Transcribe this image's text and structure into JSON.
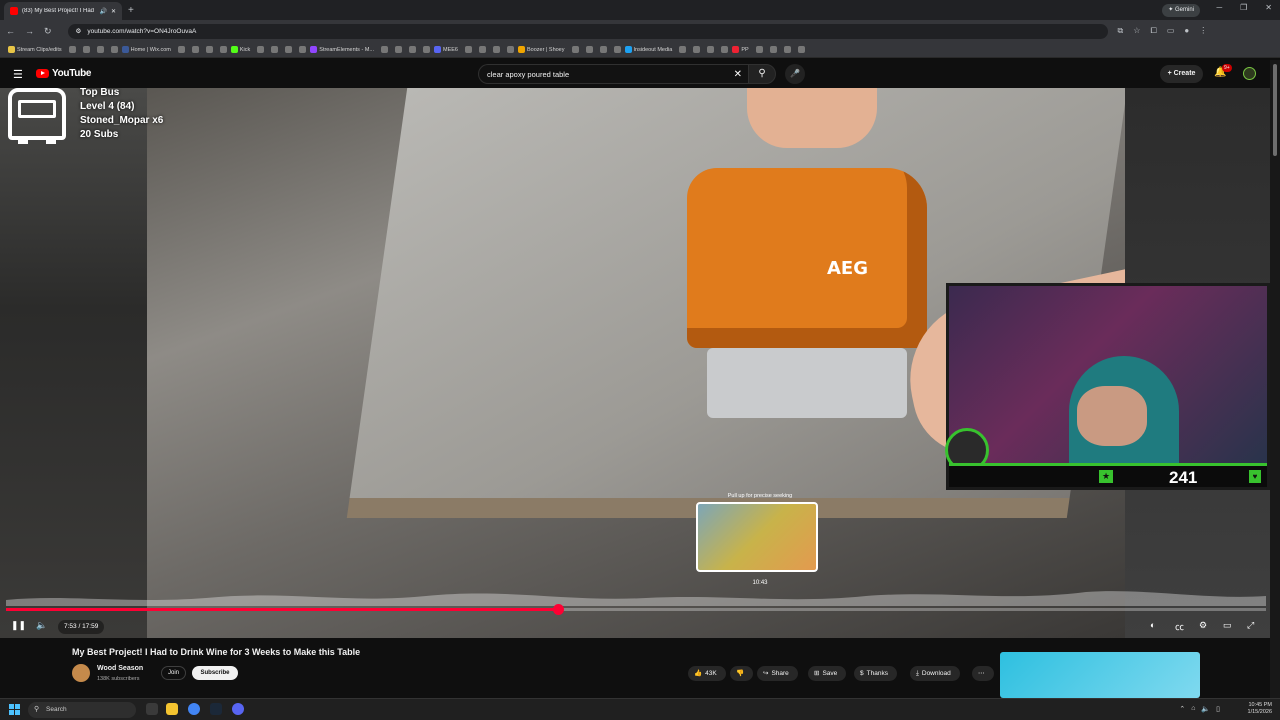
{
  "browser": {
    "tab_title": "(83) My Best Project! I Had",
    "new_tab": "+",
    "gemini_label": "Gemini",
    "url": "youtube.com/watch?v=ON4JroOuvaA",
    "bookmarks": [
      {
        "label": "Stream Clips/edits",
        "color": "#e8c547"
      },
      {
        "label": "Home | Wix.com",
        "color": "#3b5998"
      },
      {
        "label": "Kick",
        "color": "#53fc18"
      },
      {
        "label": "StreamElements - M...",
        "color": "#9146ff"
      },
      {
        "label": "MEE6",
        "color": "#5865f2"
      },
      {
        "label": "Boozer | Shoey",
        "color": "#f0a500"
      },
      {
        "label": "Insideout Media",
        "color": "#1da1f2"
      },
      {
        "label": "PP",
        "color": "#e23"
      }
    ]
  },
  "youtube": {
    "logo_text": "YouTube",
    "search_value": "clear apoxy poured table",
    "create_label": "Create",
    "notification_count": "9+"
  },
  "overlay": {
    "bus_label": "Top Bus",
    "level": "Level 4  (84)",
    "user": "Stoned_Mopar x6",
    "subs": "20 Subs"
  },
  "webcam": {
    "counter": "241"
  },
  "player": {
    "preview_hint": "Pull up for precise seeking",
    "preview_time": "10:43",
    "time_display": "7:53 / 17:59",
    "progress_fraction": 0.438
  },
  "video": {
    "title": "My Best Project! I Had to Drink Wine for 3 Weeks to Make this Table",
    "channel": "Wood Season",
    "subscribers": "138K subscribers",
    "join_label": "Join",
    "subscribe_label": "Subscribe",
    "likes": "43K",
    "share_label": "Share",
    "save_label": "Save",
    "thanks_label": "Thanks",
    "download_label": "Download"
  },
  "taskbar": {
    "search_placeholder": "Search",
    "time": "10:45 PM",
    "date": "1/15/2026"
  }
}
